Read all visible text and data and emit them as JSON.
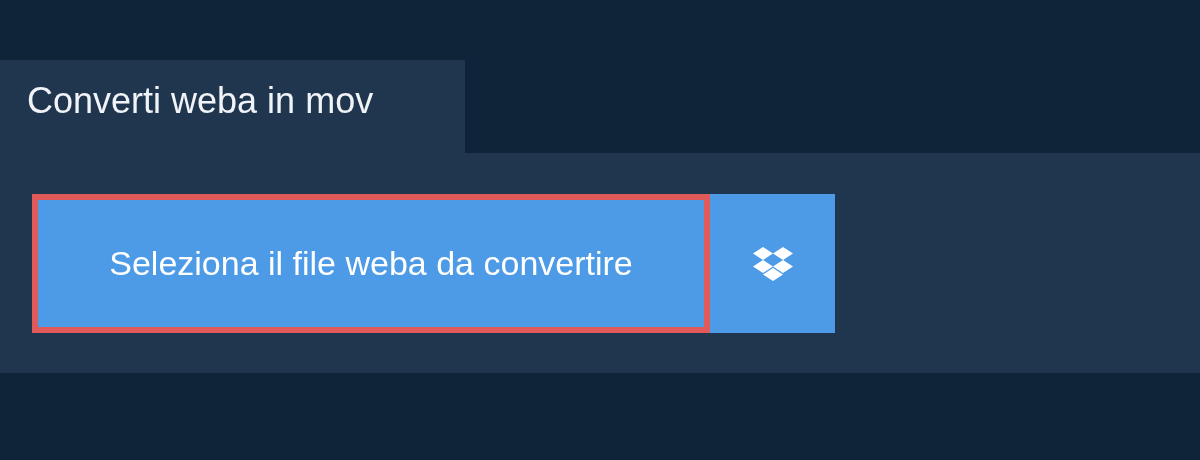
{
  "tab": {
    "label": "Converti weba in mov"
  },
  "buttons": [
    {
      "kind": "select",
      "label": "Seleziona il file weba da convertire",
      "focused": true
    },
    {
      "kind": "dropbox"
    }
  ]
}
